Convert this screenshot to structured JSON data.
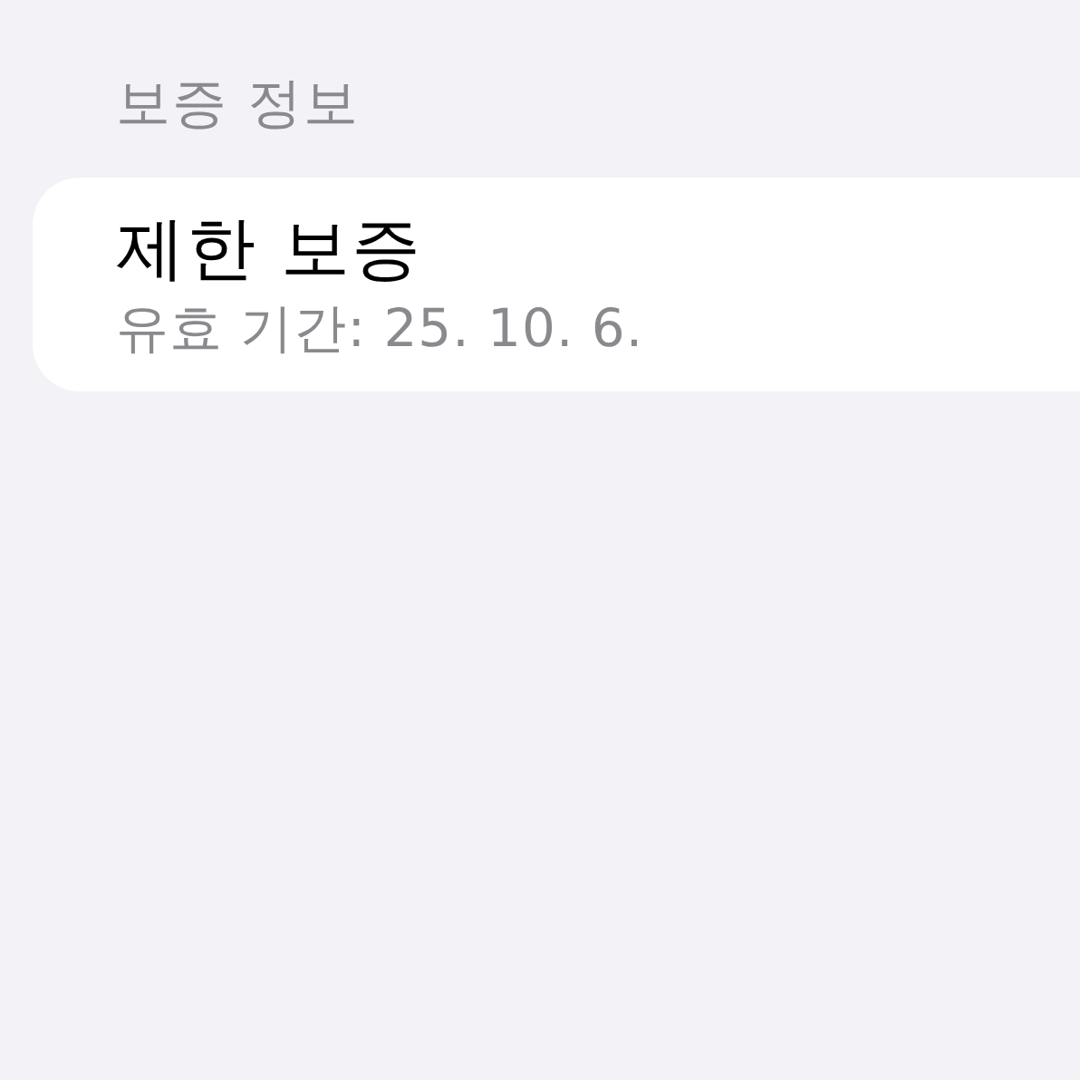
{
  "section": {
    "header": "보증 정보",
    "item": {
      "title": "제한 보증",
      "subtitle": "유효 기간: 25. 10. 6."
    }
  }
}
